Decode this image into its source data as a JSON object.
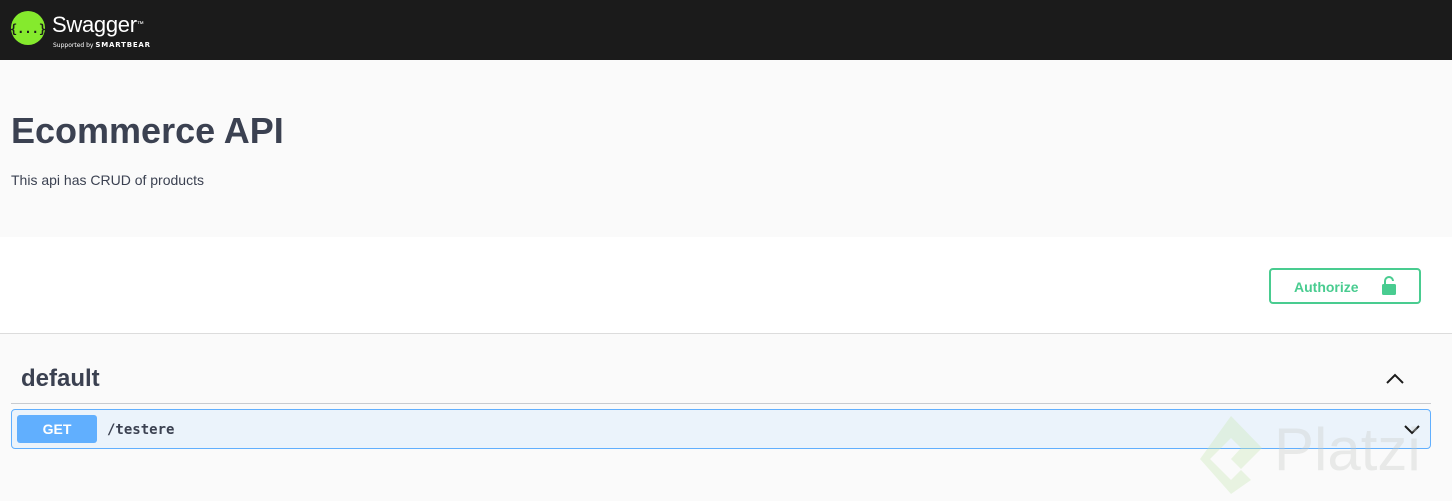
{
  "topbar": {
    "brand": "Swagger",
    "trademark": "™",
    "supported_by": "Supported by",
    "company": "SMARTBEAR",
    "logo_icon": "swagger-logo-icon",
    "logo_glyph": "{...}"
  },
  "info": {
    "title": "Ecommerce API",
    "description": "This api has CRUD of products"
  },
  "authorize": {
    "label": "Authorize",
    "icon": "lock-icon"
  },
  "tag": {
    "name": "default",
    "expanded": true,
    "icon": "chevron-up-icon"
  },
  "operations": [
    {
      "method": "GET",
      "path": "/testere",
      "icon": "chevron-down-icon"
    }
  ],
  "watermark": {
    "text": "Platzi"
  },
  "colors": {
    "topbar_bg": "#1b1b1b",
    "logo_green": "#85ea2d",
    "authorize_green": "#49cc90",
    "get_blue": "#61affe",
    "get_bg": "#ebf3fb",
    "text_dark": "#3b4151"
  }
}
